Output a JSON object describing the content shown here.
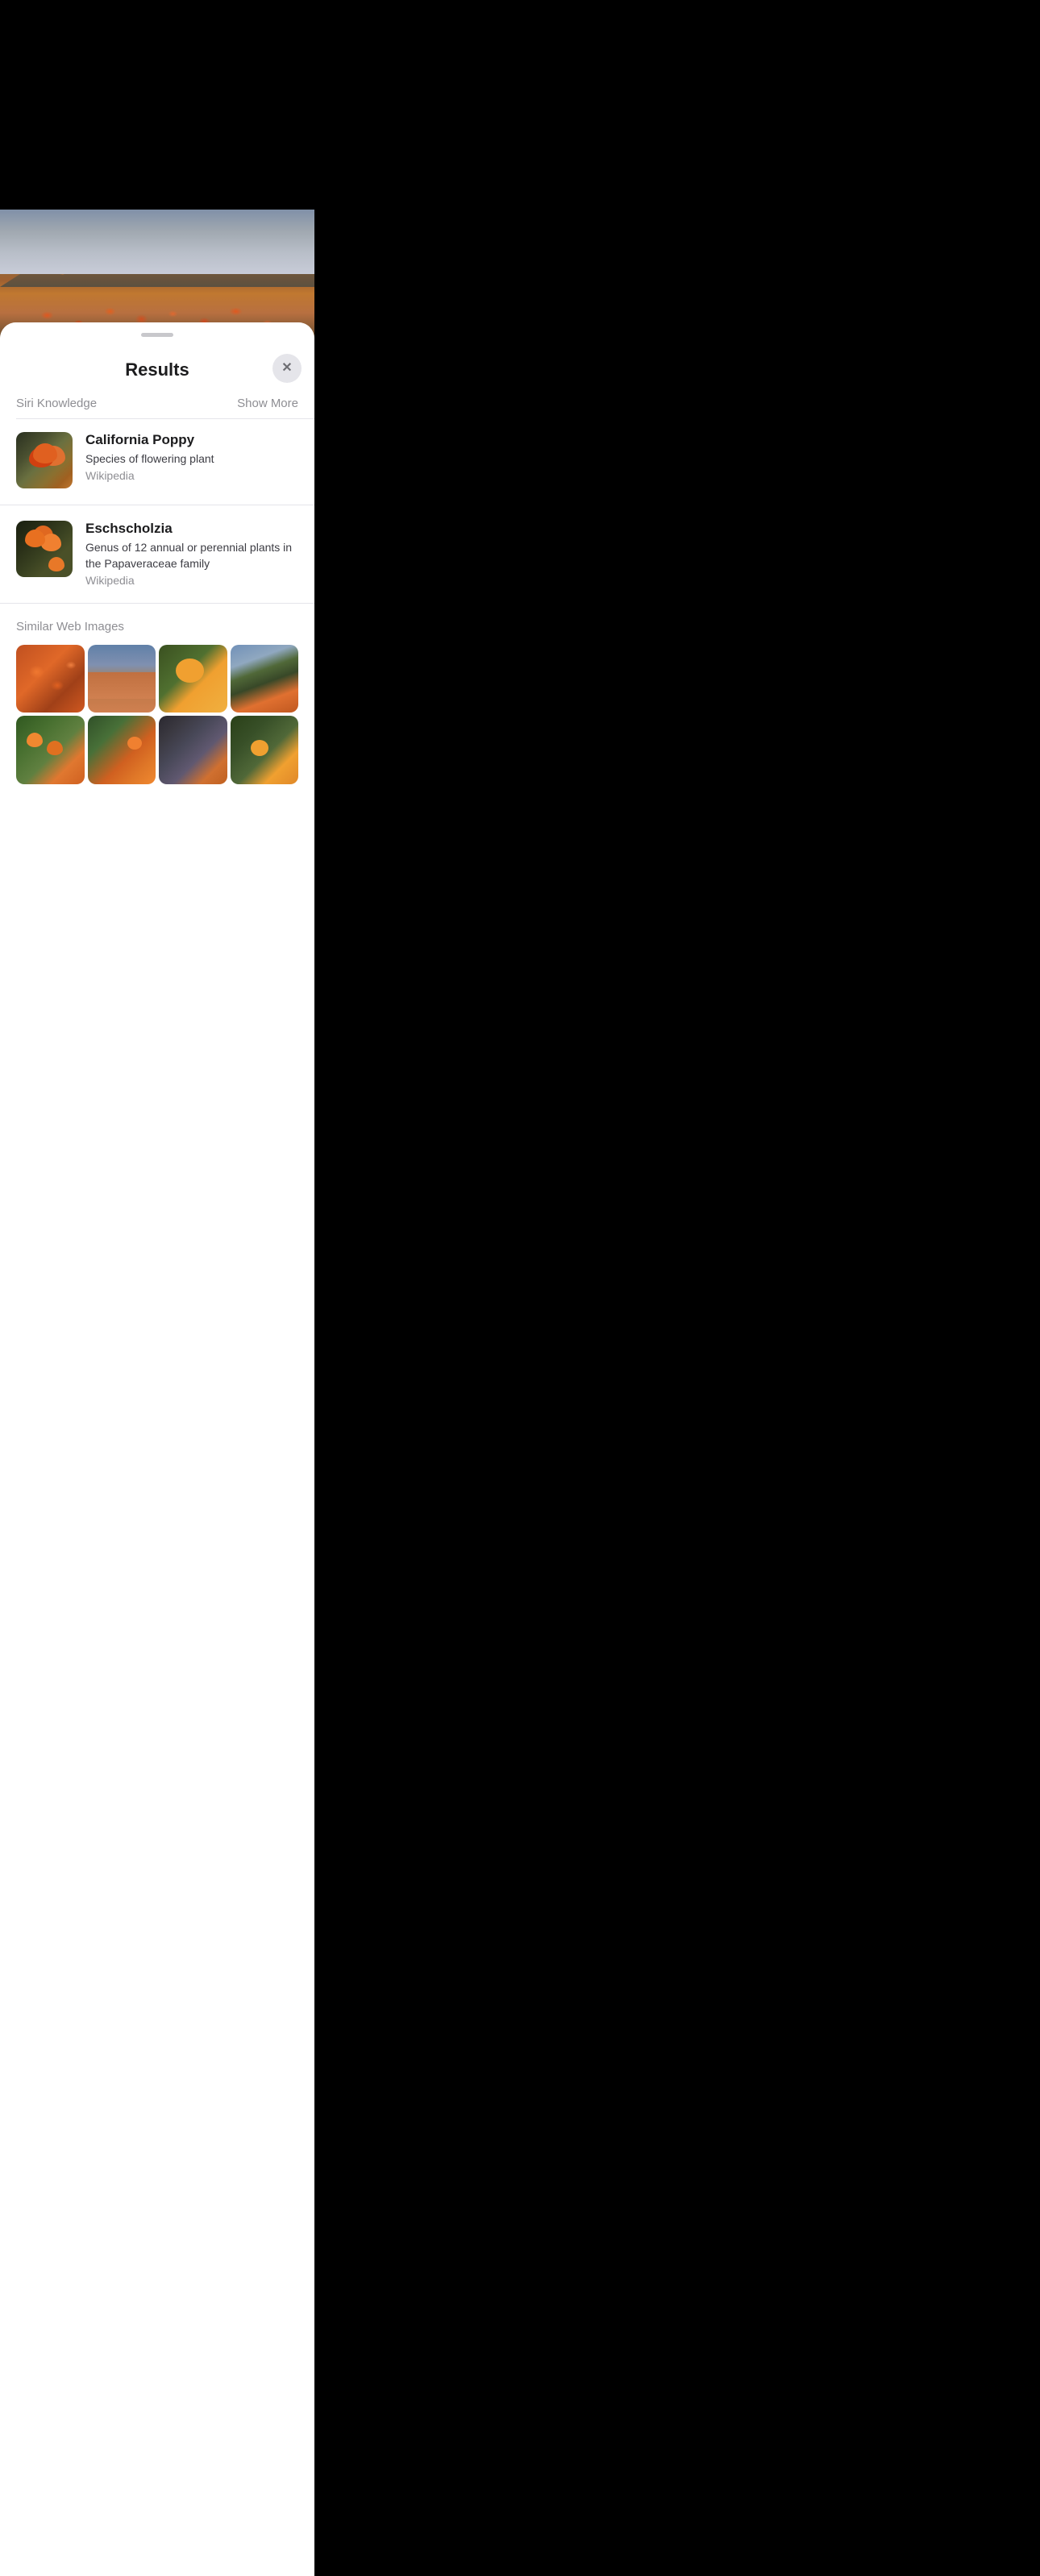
{
  "hero": {
    "alt": "California poppy field landscape"
  },
  "results_sheet": {
    "drag_handle": "drag-handle",
    "title": "Results",
    "close_button_label": "×"
  },
  "siri_knowledge": {
    "section_label": "Siri Knowledge",
    "show_more_label": "Show More",
    "items": [
      {
        "id": "california-poppy",
        "title": "California Poppy",
        "subtitle": "Species of flowering plant",
        "source": "Wikipedia"
      },
      {
        "id": "eschscholzia",
        "title": "Eschscholzia",
        "subtitle": "Genus of 12 annual or perennial plants in the Papaveraceae family",
        "source": "Wikipedia"
      }
    ]
  },
  "similar_web_images": {
    "section_label": "Similar Web Images",
    "images": [
      {
        "id": "img-1",
        "alt": "Orange poppy field close up"
      },
      {
        "id": "img-2",
        "alt": "Hillside covered in orange poppies"
      },
      {
        "id": "img-3",
        "alt": "Close up yellow orange poppy"
      },
      {
        "id": "img-4",
        "alt": "Green hills with scattered poppies"
      },
      {
        "id": "img-5",
        "alt": "Poppy flowers in green field"
      },
      {
        "id": "img-6",
        "alt": "Orange poppies in field"
      },
      {
        "id": "img-7",
        "alt": "Dark moody poppy field"
      },
      {
        "id": "img-8",
        "alt": "Yellow orange poppies"
      }
    ]
  }
}
